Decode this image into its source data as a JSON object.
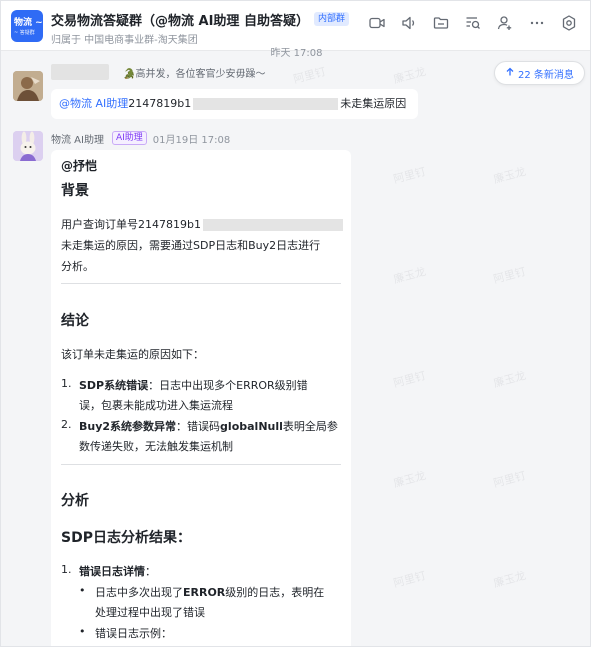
{
  "header": {
    "avatar_line1": "物流 ~",
    "avatar_line2": "~ 答疑群",
    "title": "交易物流答疑群（@物流 AI助理 自助答疑）",
    "internal_tag": "内部群",
    "subtitle": "归属于 中国电商事业群-淘天集团",
    "toolbar_icons": [
      "video-call-icon",
      "voice-call-icon",
      "folder-icon",
      "search-messages-icon",
      "add-member-icon",
      "more-icon",
      "settings-icon"
    ]
  },
  "chat": {
    "time_divider": "昨天 17:08",
    "new_messages": "22 条新消息",
    "user_message": {
      "status_text": "🐊高并发，各位客官少安毋躁～",
      "mention": "@物流 AI助理",
      "order_prefix": "2147819b1",
      "question_suffix": "未走集运原因"
    },
    "bot_message": {
      "name": "物流 AI助理",
      "tag": "AI助理",
      "time": "01月19日 17:08",
      "mention": "@抒恺",
      "sections": {
        "background_title": "背景",
        "background_p1_prefix": "用户查询订单号2147819b1",
        "background_p2": "未走集运的原因，需要通过SDP日志和Buy2日志进行",
        "background_p3": "分析。",
        "conclusion_title": "结论",
        "conclusion_intro": "该订单未走集运的原因如下：",
        "item1_num": "1.",
        "item1_bold": "SDP系统错误",
        "item1_line1_rest": "：日志中出现多个ERROR级别错",
        "item1_line2": "误，包裹未能成功进入集运流程",
        "item2_num": "2.",
        "item2_bold": "Buy2系统参数异常",
        "item2_line1_mid": "：错误码",
        "item2_code": "globalNull",
        "item2_line1_end": "表明全局参",
        "item2_line2": "数传递失败，无法触发集运机制",
        "analysis_title": "分析",
        "sdp_title": "SDP日志分析结果：",
        "sdp_item_num": "1.",
        "sdp_item_bold": "错误日志详情",
        "sdp_item_colon": "：",
        "bullet1_prefix": "日志中多次出现了",
        "bullet1_bold": "ERROR",
        "bullet1_rest": "级别的日志，表明在",
        "bullet1_line2": "处理过程中出现了错误",
        "bullet2": "错误日志示例："
      }
    }
  },
  "watermark": {
    "texts": [
      "阿里钉",
      "廉玉龙"
    ]
  },
  "colors": {
    "accent": "#3370ff",
    "ai_tag": "#7f3bf5",
    "group_avatar": "#2f6bf5"
  }
}
